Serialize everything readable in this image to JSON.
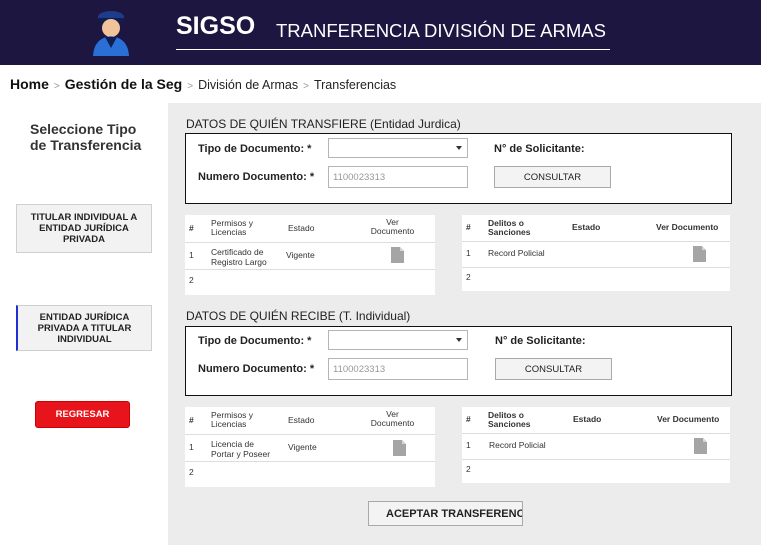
{
  "header": {
    "brand": "SIGSO",
    "module": "TRANFERENCIA DIVISIÓN DE ARMAS"
  },
  "breadcrumb": {
    "items": [
      "Home",
      "Gestión de la Seg",
      "División de Armas",
      "Transferencias"
    ],
    "sep": ">"
  },
  "sidebar": {
    "title": "Seleccione Tipo de Transferencia",
    "btn1": "TITULAR INDIVIDUAL A ENTIDAD JURÍDICA PRIVADA",
    "btn2": "ENTIDAD JURÍDICA PRIVADA A TITULAR INDIVIDUAL",
    "back": "REGRESAR"
  },
  "colors": {
    "header_bg": "#1c1640",
    "back_btn": "#e8141b",
    "active_marker": "#1f2fd6"
  },
  "transfiere": {
    "title": "DATOS DE QUIÉN TRANSFIERE (Entidad Jurdica)",
    "tipo_label": "Tipo de Documento: *",
    "tipo_value": "",
    "numero_label": "Numero Documento: *",
    "numero_placeholder": "1100023313",
    "solicitante_label": "N° de Solicitante:",
    "consultar": "CONSULTAR",
    "permisos": {
      "headers": [
        "#",
        "Permisos y Licencias",
        "Estado",
        "Ver Documento"
      ],
      "rows": [
        {
          "n": "1",
          "permiso": "Certificado de Registro Largo",
          "estado": "Vigente"
        },
        {
          "n": "2"
        }
      ]
    },
    "delitos": {
      "headers": [
        "#",
        "Delitos o Sanciones",
        "Estado",
        "Ver Documento"
      ],
      "rows": [
        {
          "n": "1",
          "delito": "Record Policial",
          "estado": ""
        },
        {
          "n": "2"
        }
      ]
    }
  },
  "recibe": {
    "title": "DATOS DE QUIÉN RECIBE (T. Individual)",
    "tipo_label": "Tipo de Documento: *",
    "tipo_value": "",
    "numero_label": "Numero Documento: *",
    "numero_placeholder": "1100023313",
    "solicitante_label": "N° de Solicitante:",
    "consultar": "CONSULTAR",
    "permisos": {
      "headers": [
        "#",
        "Permisos y Licencias",
        "Estado",
        "Ver Documento"
      ],
      "rows": [
        {
          "n": "1",
          "permiso": "Licencia de Portar y Poseer",
          "estado": "Vigente"
        },
        {
          "n": "2"
        }
      ]
    },
    "delitos": {
      "headers": [
        "#",
        "Delitos o Sanciones",
        "Estado",
        "Ver Documento"
      ],
      "rows": [
        {
          "n": "1",
          "delito": "Record Policial",
          "estado": ""
        },
        {
          "n": "2"
        }
      ]
    }
  },
  "accept_btn": "ACEPTAR TRANSFERENCIA"
}
